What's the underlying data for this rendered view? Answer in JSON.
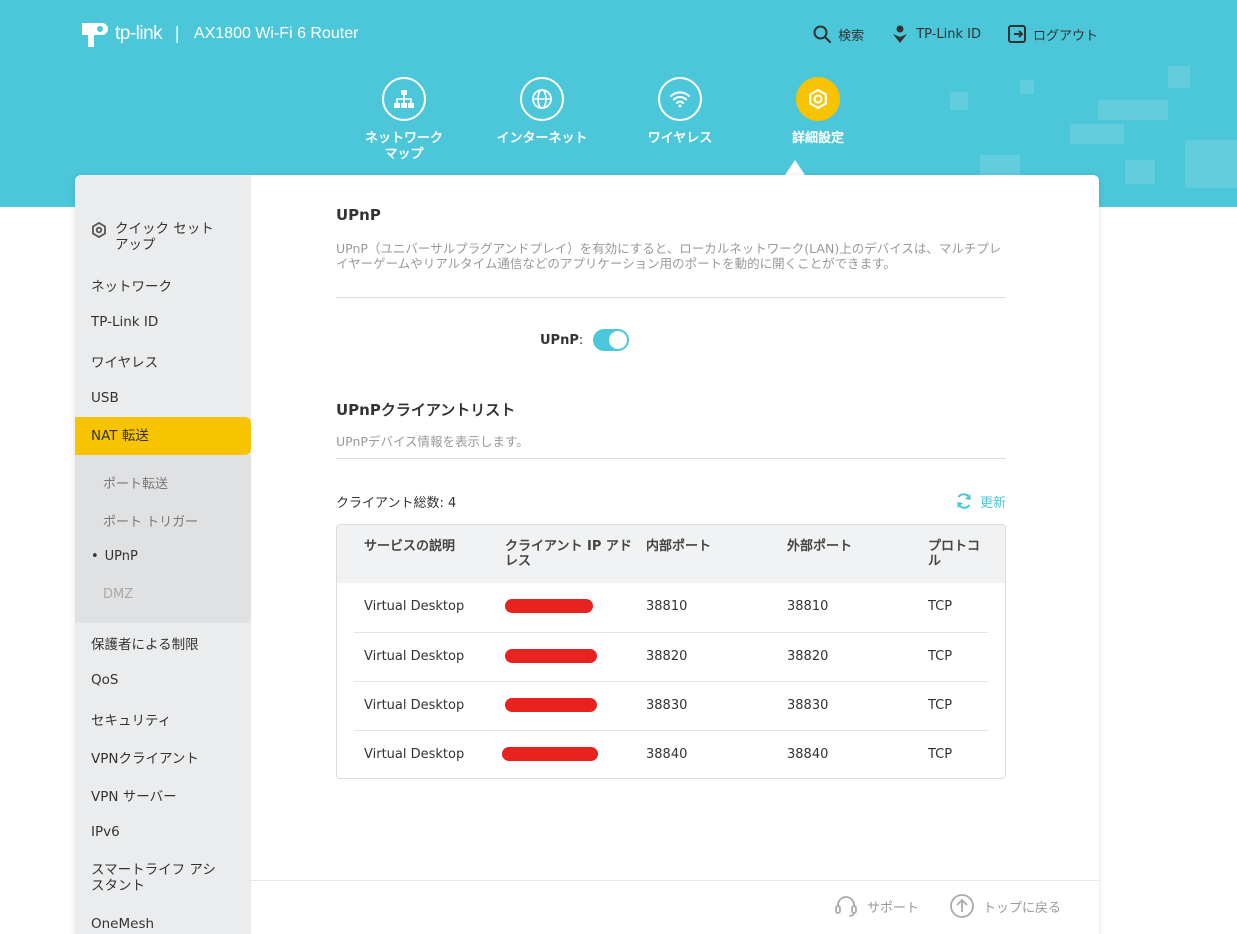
{
  "header": {
    "brand": "tp-link",
    "separator": "|",
    "model": "AX1800 Wi-Fi 6 Router",
    "links": {
      "search": "検索",
      "tplink_id": "TP-Link ID",
      "logout": "ログアウト"
    }
  },
  "main_nav": {
    "network_map": "ネットワーク\nマップ",
    "internet": "インターネット",
    "wireless": "ワイヤレス",
    "advanced": "詳細設定"
  },
  "sidebar": {
    "quick_setup": "クイック セット\nアップ",
    "items": [
      "ネットワーク",
      "TP-Link ID",
      "ワイヤレス",
      "USB",
      "NAT 転送",
      "保護者による制限",
      "QoS",
      "セキュリティ",
      "VPNクライアント",
      "VPN サーバー",
      "IPv6",
      "スマートライフ アシ\nスタント",
      "OneMesh"
    ],
    "nat_sub": [
      "ポート転送",
      "ポート トリガー",
      "UPnP",
      "DMZ"
    ]
  },
  "upnp": {
    "title": "UPnP",
    "description": "UPnP（ユニバーサルプラグアンドプレイ）を有効にすると、ローカルネットワーク(LAN)上のデバイスは、マルチプレイヤーゲームやリアルタイム通信などのアプリケーション用のポートを動的に開くことができます。",
    "toggle_label": "UPnP",
    "toggle_colon": ":",
    "enabled": true
  },
  "client_list": {
    "title": "UPnPクライアントリスト",
    "description": "UPnPデバイス情報を表示します。",
    "count_label": "クライアント総数: 4",
    "refresh_label": "更新",
    "columns": [
      "サービスの説明",
      "クライアント IP アド\nレス",
      "内部ポート",
      "外部ポート",
      "プロトコ\nル"
    ],
    "rows": [
      {
        "service": "Virtual Desktop",
        "internal": "38810",
        "external": "38810",
        "protocol": "TCP"
      },
      {
        "service": "Virtual Desktop",
        "internal": "38820",
        "external": "38820",
        "protocol": "TCP"
      },
      {
        "service": "Virtual Desktop",
        "internal": "38830",
        "external": "38830",
        "protocol": "TCP"
      },
      {
        "service": "Virtual Desktop",
        "internal": "38840",
        "external": "38840",
        "protocol": "TCP"
      }
    ]
  },
  "footer": {
    "support": "サポート",
    "back_to_top": "トップに戻る"
  },
  "colors": {
    "accent": "#4cc6d9",
    "highlight": "#f8c300",
    "redaction": "#e8221e"
  }
}
